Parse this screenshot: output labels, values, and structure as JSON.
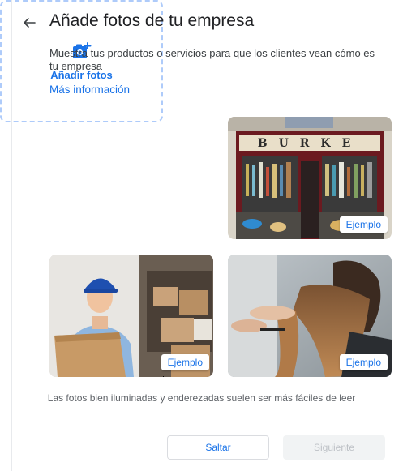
{
  "header": {
    "title": "Añade fotos de tu empresa",
    "back_icon": "arrow-back-icon"
  },
  "intro": {
    "description": "Muestra tus productos o servicios para que los clientes vean cómo es tu empresa",
    "more_info_link": "Más información"
  },
  "upload": {
    "label": "Añadir fotos",
    "icon": "add-photo-icon"
  },
  "examples": [
    {
      "badge": "Ejemplo",
      "shop_sign": "BURKE"
    },
    {
      "badge": "Ejemplo"
    },
    {
      "badge": "Ejemplo"
    }
  ],
  "hint": "Las fotos bien iluminadas y enderezadas suelen ser más fáciles de leer",
  "buttons": {
    "skip": "Saltar",
    "next": "Siguiente"
  },
  "colors": {
    "accent": "#1a73e8",
    "dashed_border": "#aecbfa",
    "disabled_bg": "#f1f3f4",
    "disabled_text": "#bdc1c6"
  }
}
